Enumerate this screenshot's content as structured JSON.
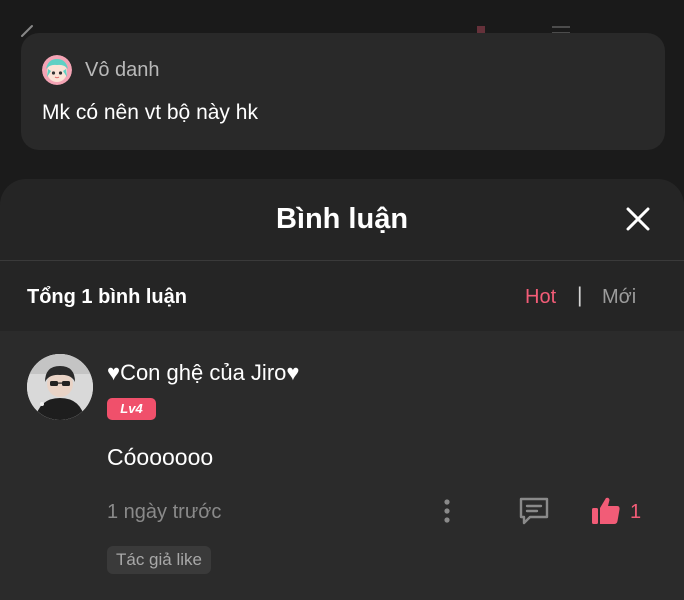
{
  "post": {
    "author": "Vô danh",
    "text": "Mk có nên vt bộ này hk"
  },
  "comments_sheet": {
    "title": "Bình luận",
    "total_label": "Tổng 1 bình luận",
    "sort": {
      "hot": "Hot",
      "separator": "|",
      "new": "Mới",
      "active": "Hot"
    },
    "items": [
      {
        "username": "♥Con ghệ của Jiro♥",
        "level": "Lv4",
        "text": "Cóoooooo",
        "time": "1 ngày trước",
        "likes": "1",
        "badge": "Tác giả like"
      }
    ]
  },
  "colors": {
    "accent": "#f25c77",
    "level_badge": "#f0506b",
    "sheet_bg": "#252525",
    "card_bg": "#292929"
  },
  "icons": [
    "back-icon",
    "anime-avatar-icon",
    "close-icon",
    "more-vertical-icon",
    "reply-icon",
    "thumbs-up-icon"
  ]
}
